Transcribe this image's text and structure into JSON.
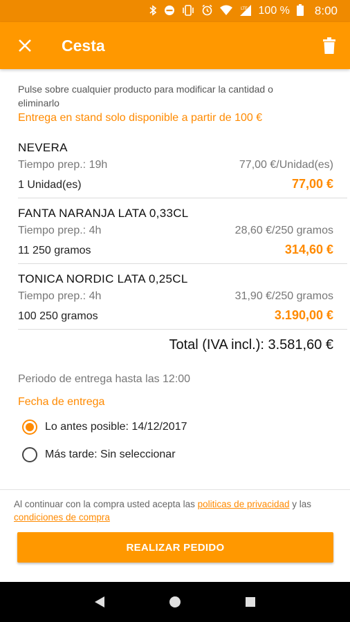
{
  "status_bar": {
    "battery": "100 %",
    "time": "8:00",
    "icons": [
      "bluetooth-icon",
      "do-not-disturb-icon",
      "vibrate-icon",
      "alarm-icon",
      "wifi-icon",
      "lte-signal-icon",
      "battery-icon"
    ]
  },
  "app_bar": {
    "title": "Cesta",
    "close_icon": "close-icon",
    "delete_icon": "trash-icon"
  },
  "hint": "Pulse sobre cualquier producto para modificar la cantidad o eliminarlo",
  "notice": "Entrega en stand solo disponible a partir de 100 €",
  "products": [
    {
      "name": "NEVERA",
      "prep": "Tiempo prep.: 19h",
      "unit_price": "77,00 €/Unidad(es)",
      "quantity": "1 Unidad(es)",
      "price": "77,00 €"
    },
    {
      "name": "FANTA NARANJA LATA 0,33CL",
      "prep": "Tiempo prep.: 4h",
      "unit_price": "28,60 €/250 gramos",
      "quantity": "11 250 gramos",
      "price": "314,60 €"
    },
    {
      "name": "TONICA NORDIC LATA 0,25CL",
      "prep": "Tiempo prep.: 4h",
      "unit_price": "31,90 €/250 gramos",
      "quantity": "100 250 gramos",
      "price": "3.190,00 €"
    }
  ],
  "total": "Total (IVA incl.): 3.581,60 €",
  "period": "Periodo de entrega hasta las 12:00",
  "delivery_date_label": "Fecha de entrega",
  "delivery_options": [
    {
      "label": "Lo antes posible: 14/12/2017",
      "selected": true
    },
    {
      "label": "Más tarde: Sin seleccionar",
      "selected": false
    }
  ],
  "legal": {
    "prefix": "Al continuar con la compra usted acepta las ",
    "privacy_link": "politicas de privacidad",
    "middle": " y las ",
    "terms_link": "condiciones de compra"
  },
  "order_button": "REALIZAR PEDIDO",
  "colors": {
    "accent": "#ff9800",
    "price": "#ff8a00",
    "status_bar": "#ef8a00"
  }
}
